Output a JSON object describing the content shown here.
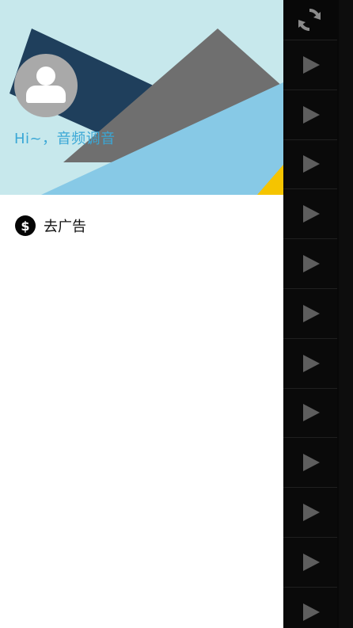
{
  "drawer": {
    "greeting": "Hi~，音频调音",
    "menu": [
      {
        "label": "去广告",
        "icon": "dollar-circle-icon"
      }
    ]
  },
  "right_panel": {
    "refresh_icon": "refresh-icon",
    "play_button_count": 12,
    "play_icon": "play-icon"
  },
  "colors": {
    "header_bg": "#c7e8ec",
    "navy_shape": "#1f3f5c",
    "gray_shape": "#6f6f6f",
    "light_blue_shape": "#87c9e6",
    "yellow_accent": "#f5c400",
    "greeting_text": "#3aa7d6",
    "right_panel_bg": "#080808"
  }
}
